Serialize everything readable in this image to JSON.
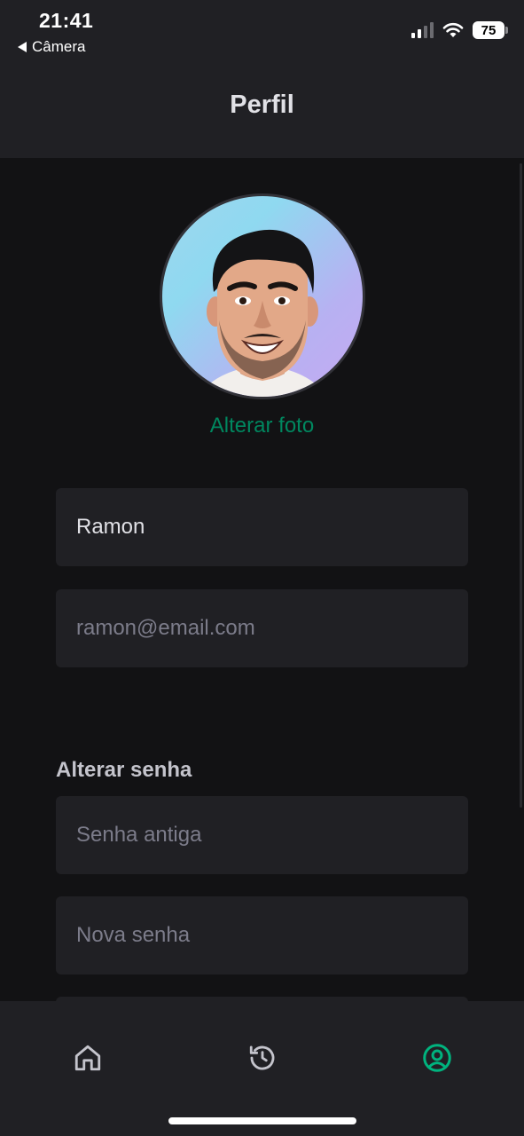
{
  "status_bar": {
    "time": "21:41",
    "back_label": "Câmera",
    "battery": "75"
  },
  "header": {
    "title": "Perfil"
  },
  "profile": {
    "change_photo_label": "Alterar foto",
    "name_value": "Ramon",
    "email_placeholder": "ramon@email.com"
  },
  "password": {
    "section_title": "Alterar senha",
    "old_placeholder": "Senha antiga",
    "new_placeholder": "Nova senha"
  },
  "tabbar": {
    "items": [
      {
        "icon": "home-icon",
        "active": false
      },
      {
        "icon": "history-icon",
        "active": false
      },
      {
        "icon": "user-circle-icon",
        "active": true
      }
    ],
    "active_color": "#00b37e",
    "inactive_color": "#c4c4cc"
  },
  "colors": {
    "background": "#121214",
    "surface": "#202024",
    "accent": "#00875f"
  }
}
